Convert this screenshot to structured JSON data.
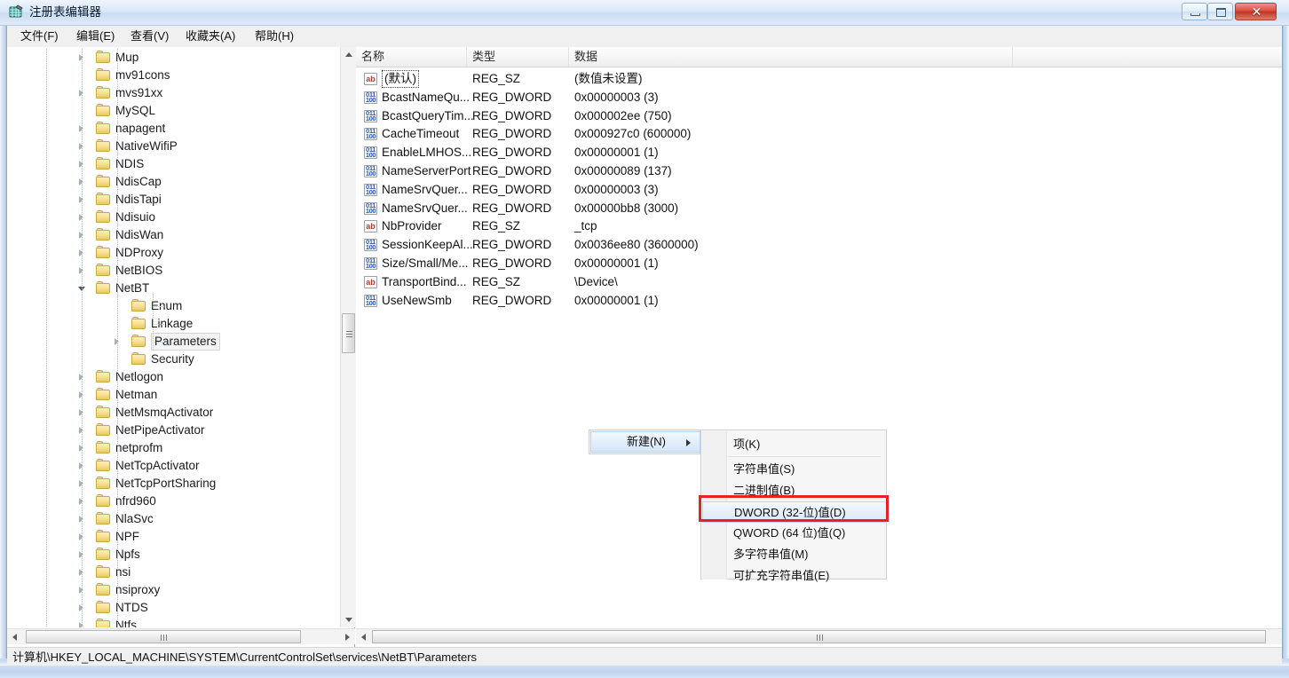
{
  "window": {
    "title": "注册表编辑器",
    "icon": "registry-editor-icon",
    "controls": {
      "minimize": "—",
      "maximize": "□",
      "close": "✕"
    }
  },
  "menubar": [
    {
      "label": "文件(F)",
      "key": "F"
    },
    {
      "label": "编辑(E)",
      "key": "E"
    },
    {
      "label": "查看(V)",
      "key": "V"
    },
    {
      "label": "收藏夹(A)",
      "key": "A"
    },
    {
      "label": "帮助(H)",
      "key": "H"
    }
  ],
  "tree": {
    "items": [
      {
        "label": "Mup",
        "depth": 1,
        "expander": "collapsed",
        "selected": false
      },
      {
        "label": "mv91cons",
        "depth": 1,
        "expander": "none",
        "selected": false
      },
      {
        "label": "mvs91xx",
        "depth": 1,
        "expander": "collapsed",
        "selected": false
      },
      {
        "label": "MySQL",
        "depth": 1,
        "expander": "none",
        "selected": false
      },
      {
        "label": "napagent",
        "depth": 1,
        "expander": "collapsed",
        "selected": false
      },
      {
        "label": "NativeWifiP",
        "depth": 1,
        "expander": "collapsed",
        "selected": false
      },
      {
        "label": "NDIS",
        "depth": 1,
        "expander": "collapsed",
        "selected": false
      },
      {
        "label": "NdisCap",
        "depth": 1,
        "expander": "collapsed",
        "selected": false
      },
      {
        "label": "NdisTapi",
        "depth": 1,
        "expander": "collapsed",
        "selected": false
      },
      {
        "label": "Ndisuio",
        "depth": 1,
        "expander": "collapsed",
        "selected": false
      },
      {
        "label": "NdisWan",
        "depth": 1,
        "expander": "collapsed",
        "selected": false
      },
      {
        "label": "NDProxy",
        "depth": 1,
        "expander": "collapsed",
        "selected": false
      },
      {
        "label": "NetBIOS",
        "depth": 1,
        "expander": "collapsed",
        "selected": false
      },
      {
        "label": "NetBT",
        "depth": 1,
        "expander": "expanded",
        "selected": false
      },
      {
        "label": "Enum",
        "depth": 2,
        "expander": "none",
        "selected": false
      },
      {
        "label": "Linkage",
        "depth": 2,
        "expander": "none",
        "selected": false
      },
      {
        "label": "Parameters",
        "depth": 2,
        "expander": "collapsed",
        "selected": true
      },
      {
        "label": "Security",
        "depth": 2,
        "expander": "none",
        "selected": false
      },
      {
        "label": "Netlogon",
        "depth": 1,
        "expander": "collapsed",
        "selected": false
      },
      {
        "label": "Netman",
        "depth": 1,
        "expander": "collapsed",
        "selected": false
      },
      {
        "label": "NetMsmqActivator",
        "depth": 1,
        "expander": "collapsed",
        "selected": false
      },
      {
        "label": "NetPipeActivator",
        "depth": 1,
        "expander": "collapsed",
        "selected": false
      },
      {
        "label": "netprofm",
        "depth": 1,
        "expander": "collapsed",
        "selected": false
      },
      {
        "label": "NetTcpActivator",
        "depth": 1,
        "expander": "collapsed",
        "selected": false
      },
      {
        "label": "NetTcpPortSharing",
        "depth": 1,
        "expander": "collapsed",
        "selected": false
      },
      {
        "label": "nfrd960",
        "depth": 1,
        "expander": "collapsed",
        "selected": false
      },
      {
        "label": "NlaSvc",
        "depth": 1,
        "expander": "collapsed",
        "selected": false
      },
      {
        "label": "NPF",
        "depth": 1,
        "expander": "collapsed",
        "selected": false
      },
      {
        "label": "Npfs",
        "depth": 1,
        "expander": "collapsed",
        "selected": false
      },
      {
        "label": "nsi",
        "depth": 1,
        "expander": "collapsed",
        "selected": false
      },
      {
        "label": "nsiproxy",
        "depth": 1,
        "expander": "collapsed",
        "selected": false
      },
      {
        "label": "NTDS",
        "depth": 1,
        "expander": "collapsed",
        "selected": false
      },
      {
        "label": "Ntfs",
        "depth": 1,
        "expander": "collapsed",
        "selected": false
      }
    ]
  },
  "list": {
    "columns": [
      {
        "label": "名称"
      },
      {
        "label": "类型"
      },
      {
        "label": "数据"
      }
    ],
    "rows": [
      {
        "name": "(默认)",
        "type": "REG_SZ",
        "data": "(数值未设置)",
        "icon": "string-value-icon",
        "selected": true
      },
      {
        "name": "BcastNameQu...",
        "type": "REG_DWORD",
        "data": "0x00000003 (3)",
        "icon": "dword-value-icon",
        "selected": false
      },
      {
        "name": "BcastQueryTim...",
        "type": "REG_DWORD",
        "data": "0x000002ee (750)",
        "icon": "dword-value-icon",
        "selected": false
      },
      {
        "name": "CacheTimeout",
        "type": "REG_DWORD",
        "data": "0x000927c0 (600000)",
        "icon": "dword-value-icon",
        "selected": false
      },
      {
        "name": "EnableLMHOS...",
        "type": "REG_DWORD",
        "data": "0x00000001 (1)",
        "icon": "dword-value-icon",
        "selected": false
      },
      {
        "name": "NameServerPort",
        "type": "REG_DWORD",
        "data": "0x00000089 (137)",
        "icon": "dword-value-icon",
        "selected": false
      },
      {
        "name": "NameSrvQuer...",
        "type": "REG_DWORD",
        "data": "0x00000003 (3)",
        "icon": "dword-value-icon",
        "selected": false
      },
      {
        "name": "NameSrvQuer...",
        "type": "REG_DWORD",
        "data": "0x00000bb8 (3000)",
        "icon": "dword-value-icon",
        "selected": false
      },
      {
        "name": "NbProvider",
        "type": "REG_SZ",
        "data": "_tcp",
        "icon": "string-value-icon",
        "selected": false
      },
      {
        "name": "SessionKeepAl...",
        "type": "REG_DWORD",
        "data": "0x0036ee80 (3600000)",
        "icon": "dword-value-icon",
        "selected": false
      },
      {
        "name": "Size/Small/Me...",
        "type": "REG_DWORD",
        "data": "0x00000001 (1)",
        "icon": "dword-value-icon",
        "selected": false
      },
      {
        "name": "TransportBind...",
        "type": "REG_SZ",
        "data": "\\Device\\",
        "icon": "string-value-icon",
        "selected": false
      },
      {
        "name": "UseNewSmb",
        "type": "REG_DWORD",
        "data": "0x00000001 (1)",
        "icon": "dword-value-icon",
        "selected": false
      }
    ]
  },
  "context_menu": {
    "parent": {
      "label": "新建(N)",
      "highlighted": true,
      "has_submenu": true
    },
    "items": [
      {
        "label": "项(K)",
        "highlighted": false
      },
      {
        "label": "字符串值(S)",
        "highlighted": false
      },
      {
        "label": "二进制值(B)",
        "highlighted": false
      },
      {
        "label": "DWORD (32-位)值(D)",
        "highlighted": true
      },
      {
        "label": "QWORD (64 位)值(Q)",
        "highlighted": false
      },
      {
        "label": "多字符串值(M)",
        "highlighted": false
      },
      {
        "label": "可扩充字符串值(E)",
        "highlighted": false
      }
    ],
    "annotation_color": "#e8231f"
  },
  "statusbar": {
    "path": "计算机\\HKEY_LOCAL_MACHINE\\SYSTEM\\CurrentControlSet\\services\\NetBT\\Parameters"
  }
}
